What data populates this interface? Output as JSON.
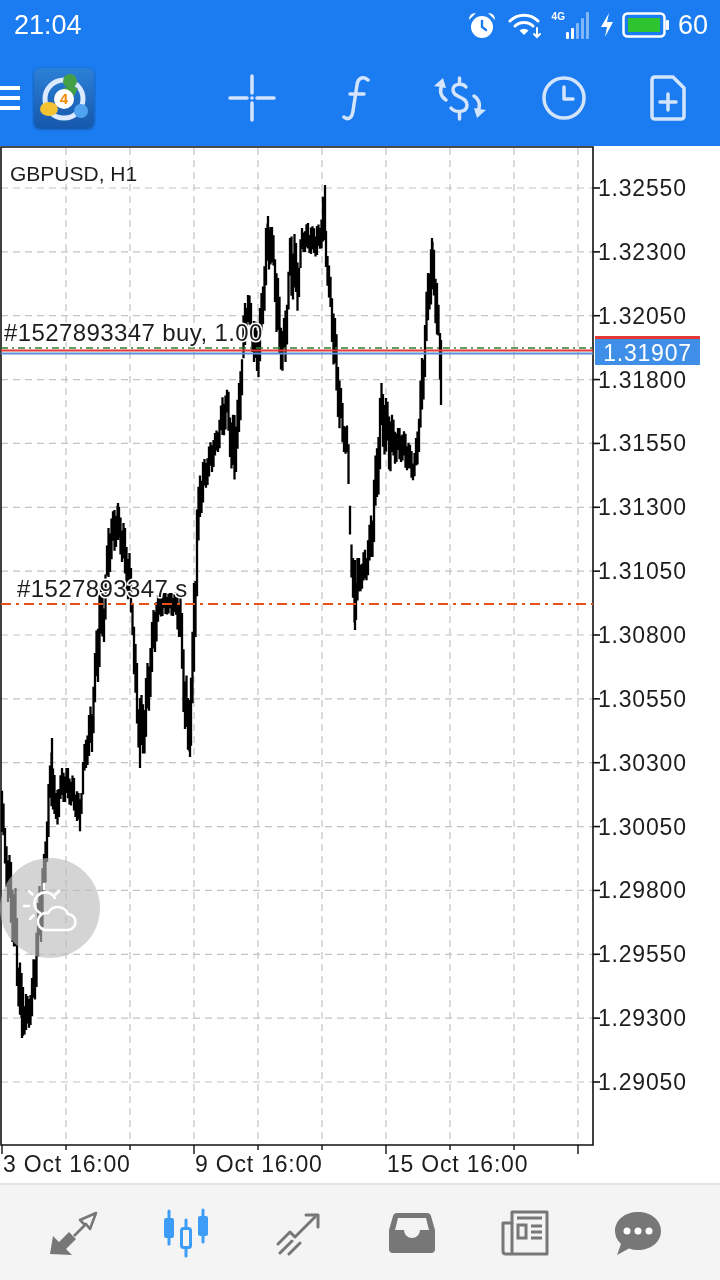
{
  "status_bar": {
    "time": "21:04",
    "network_type": "4G",
    "battery_percent": "60"
  },
  "toolbar": {
    "logo_badge": "4"
  },
  "chart": {
    "symbol_timeframe": "GBPUSD, H1",
    "price_axis": [
      "1.32550",
      "1.32300",
      "1.32050",
      "1.31800",
      "1.31550",
      "1.31300",
      "1.31050",
      "1.30800",
      "1.30550",
      "1.30300",
      "1.30050",
      "1.29800",
      "1.29550",
      "1.29300",
      "1.29050"
    ],
    "time_axis": [
      "3 Oct 16:00",
      "9 Oct 16:00",
      "15 Oct 16:00"
    ],
    "current_price": "1.31907",
    "orders": [
      {
        "kind": "buy",
        "label": "#1527893347 buy, 1.00"
      },
      {
        "kind": "sell",
        "label": "#1527893347 s"
      }
    ]
  },
  "bottom_nav": {
    "items": [
      {
        "selected": false
      },
      {
        "selected": true
      },
      {
        "selected": false
      },
      {
        "selected": false
      },
      {
        "selected": false
      },
      {
        "selected": false
      }
    ]
  }
}
